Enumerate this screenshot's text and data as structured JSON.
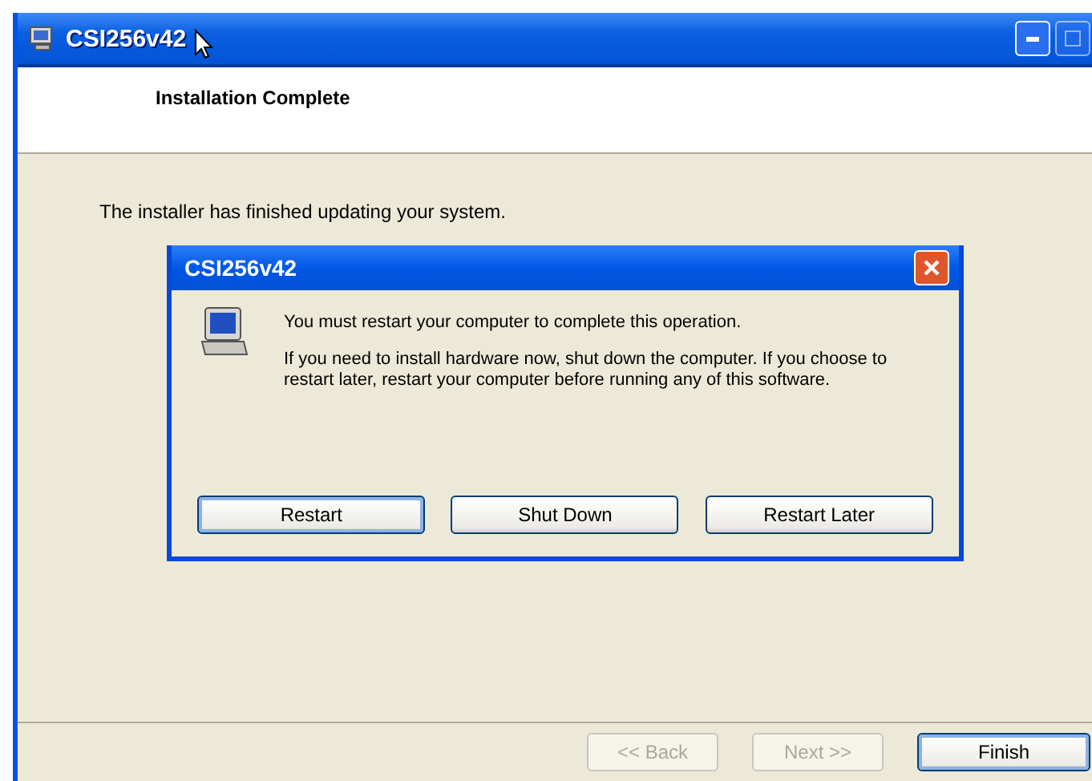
{
  "window": {
    "title": "CSI256v42"
  },
  "header": {
    "title": "Installation Complete"
  },
  "body": {
    "message": "The installer has finished updating your system."
  },
  "dialog": {
    "title": "CSI256v42",
    "message": "You must restart your computer to complete this operation.",
    "detail": "If you need to install hardware now, shut down the computer. If you choose to restart later, restart your computer before running any of this software.",
    "buttons": [
      {
        "label": "Restart",
        "selected": true
      },
      {
        "label": "Shut Down",
        "selected": false
      },
      {
        "label": "Restart Later",
        "selected": false
      }
    ]
  },
  "footer": {
    "buttons": [
      {
        "label": "<< Back",
        "disabled": true,
        "selected": false
      },
      {
        "label": "Next >>",
        "disabled": true,
        "selected": false
      },
      {
        "label": "Finish",
        "disabled": false,
        "selected": true
      }
    ]
  }
}
